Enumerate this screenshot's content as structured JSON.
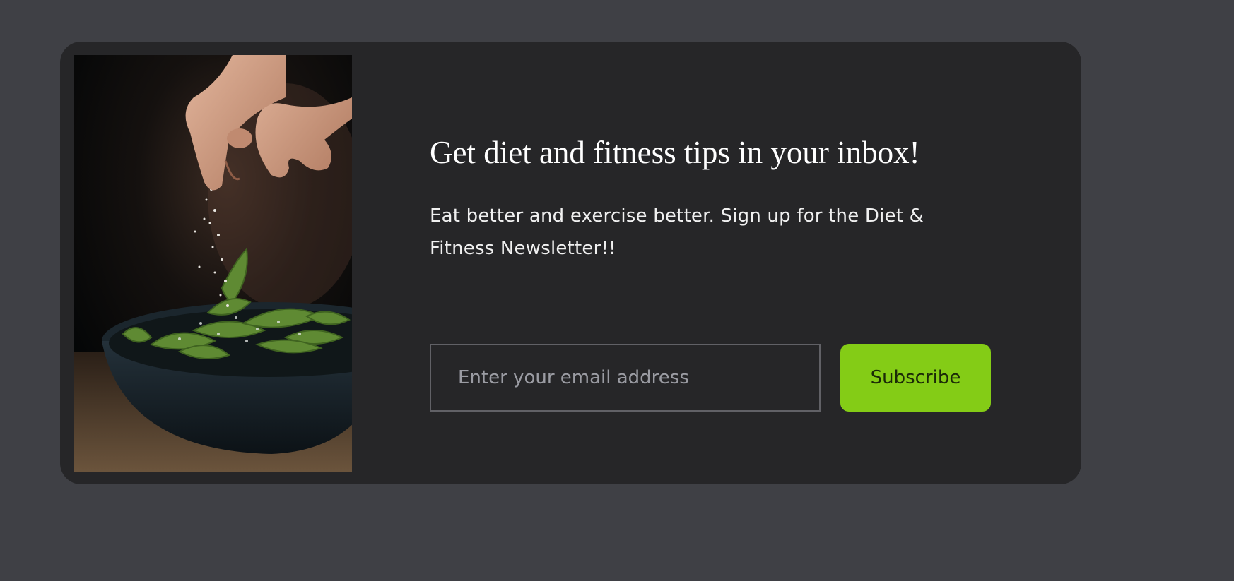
{
  "newsletter": {
    "image_alt": "Hand sprinkling salt over a bowl of edamame",
    "headline": "Get diet and fitness tips in your inbox!",
    "description": "Eat better and exercise better. Sign up for the Diet & Fitness Newsletter!!",
    "email": {
      "value": "",
      "placeholder": "Enter your email address"
    },
    "subscribe_label": "Subscribe"
  },
  "colors": {
    "page_background": "#3f4045",
    "card_background": "#262628",
    "accent": "#84cc16",
    "input_border": "#616166",
    "placeholder": "#9b9ca3"
  }
}
